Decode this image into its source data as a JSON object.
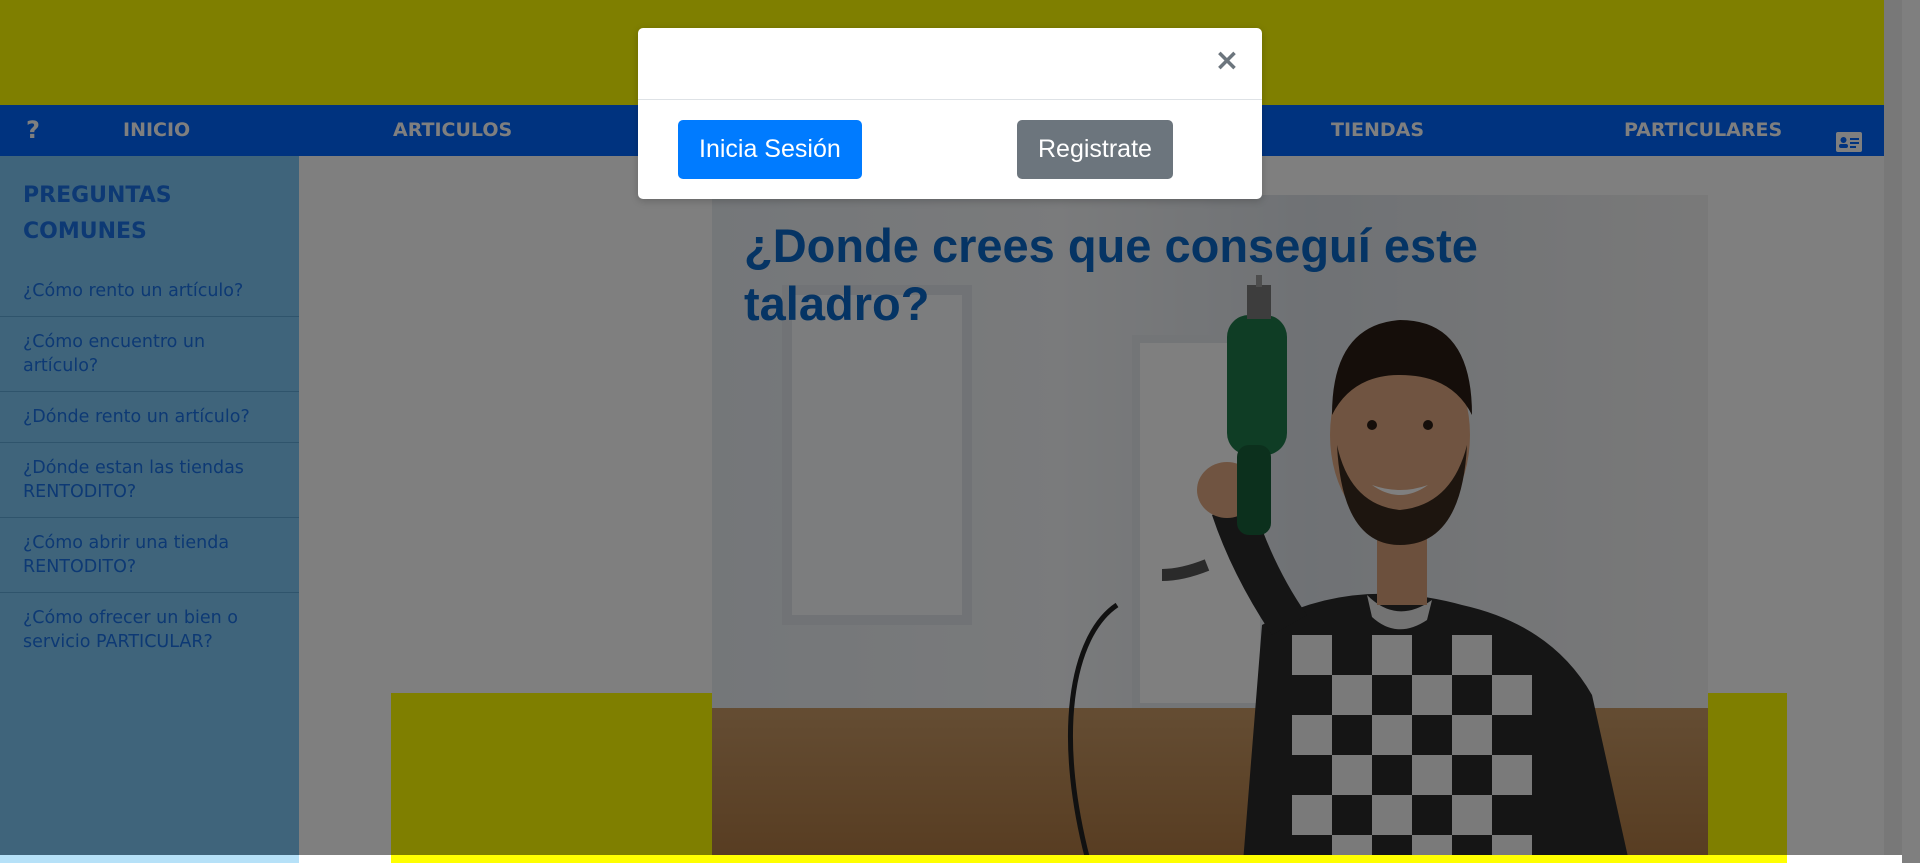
{
  "navbar": {
    "help": "?",
    "items": [
      "INICIO",
      "ARTICULOS",
      "TIENDAS",
      "PARTICULARES"
    ],
    "card_icon": "id-card-icon"
  },
  "sidebar": {
    "title_line1": "PREGUNTAS",
    "title_line2": "COMUNES",
    "questions": [
      "¿Cómo rento un artículo?",
      "¿Cómo encuentro un artículo?",
      "¿Dónde rento un artículo?",
      "¿Dónde estan las tiendas RENTODITO?",
      "¿Cómo abrir una tienda RENTODITO?",
      "¿Cómo ofrecer un bien o servicio PARTICULAR?"
    ]
  },
  "hero": {
    "title": "¿Donde crees que conseguí este taladro?"
  },
  "modal": {
    "close": "×",
    "login_label": "Inicia Sesión",
    "register_label": "Registrate"
  },
  "colors": {
    "banner": "#ffff00",
    "navbar": "#0066ff",
    "sidebar": "#7fc8f7",
    "primary_button": "#007bff",
    "secondary_button": "#6c757d"
  }
}
